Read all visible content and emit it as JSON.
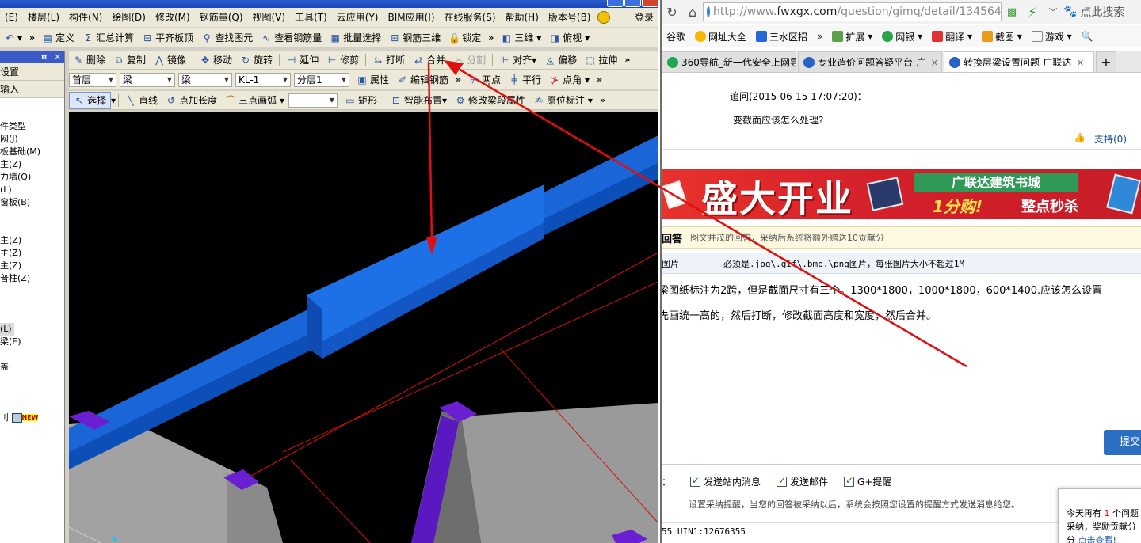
{
  "cad": {
    "menu": [
      "(E)",
      "楼层(L)",
      "构件(N)",
      "绘图(D)",
      "修改(M)",
      "钢筋量(Q)",
      "视图(V)",
      "工具(T)",
      "云应用(Y)",
      "BIM应用(I)",
      "在线服务(S)",
      "帮助(H)",
      "版本号(B)"
    ],
    "login": "登录",
    "toolbar1": {
      "chevron": "»",
      "items": [
        "定义",
        "汇总计算",
        "平齐板顶",
        "查找图元",
        "查看钢筋量",
        "批量选择",
        "钢筋三维",
        "锁定"
      ],
      "view_3d": "三维",
      "view_top": "俯视"
    },
    "toolbar2": [
      "删除",
      "复制",
      "镜像",
      "移动",
      "旋转",
      "延伸",
      "修剪",
      "打断",
      "合并",
      "分割",
      "对齐",
      "偏移",
      "拉伸"
    ],
    "toolbar3": {
      "floor": "首层",
      "type1": "梁",
      "type2": "梁",
      "member": "KL-1",
      "layer": "分层1",
      "buttons": [
        "属性",
        "编辑钢筋",
        "两点",
        "平行",
        "点角"
      ]
    },
    "toolbar4": {
      "buttons": [
        "选择",
        "直线",
        "点加长度",
        "三点画弧",
        "矩形",
        "智能布置",
        "修改梁段属性",
        "原位标注"
      ]
    },
    "left_panel": {
      "head_pin": "𝛑",
      "head_close": "×",
      "tab1": "设置",
      "tab2": "输入",
      "tree": [
        "件类型",
        "网(J)",
        "板基础(M)",
        "主(Z)",
        "力墙(Q)",
        "(L)",
        "窗板(B)",
        "",
        "",
        "主(Z)",
        "主(Z)",
        "主(Z)",
        "普柱(Z)",
        "",
        "",
        "",
        "(L)",
        "梁(E)",
        "",
        "盖",
        "",
        "",
        "",
        "刂"
      ],
      "new_badge": "NEW"
    }
  },
  "browser": {
    "url_prefix": "http://www.",
    "url_host": "fwxgx.com",
    "url_path": "/question/gimq/detail/1345649",
    "search_placeholder": "点此搜索",
    "favorites": [
      "谷歌",
      "网址大全",
      "三水区招",
      "扩展",
      "网银",
      "翻译",
      "截图",
      "游戏"
    ],
    "fav_chevron": "»",
    "tabs": [
      {
        "title": "360导航_新一代安全上网导",
        "active": false
      },
      {
        "title": "专业造价问题答疑平台-广",
        "active": false
      },
      {
        "title": "转换层梁设置问题-广联达",
        "active": true
      }
    ],
    "new_tab": "+",
    "question": {
      "followup": "追问(2015-06-15 17:07:20)：",
      "followup_text": "变截面应该怎么处理?",
      "support": "支持(0)"
    },
    "banner": {
      "big": "盛大开业",
      "green": "广联达建筑书城",
      "yellow": "1分购!",
      "white": "整点秒杀"
    },
    "answer_bar": {
      "label": "回答",
      "hint": "图文并茂的回答，采纳后系统将额外赠送10贡献分"
    },
    "image_bar": {
      "label": "图片",
      "hint": "必须是.jpg\\.gif\\.bmp.\\png图片，每张图片大小不超过1M"
    },
    "answer_lines": [
      "梁图纸标注为2跨，但是截面尺寸有三个。1300*1800，1000*1800，600*1400.应该怎么设置",
      "先画统一高的，然后打断，修改截面高度和宽度，然后合并。"
    ],
    "submit": "提交回",
    "options": [
      "发送站内消息",
      "发送邮件",
      "G+提醒"
    ],
    "options_colon": "：",
    "options_note": "设置采纳提醒，当您的回答被采纳以后，系统会按照您设置的提醒方式发送消息给您。",
    "footer": "55 UIN1:12676355",
    "popup": {
      "line1_a": "今天再有",
      "line1_n": "1",
      "line1_b": "个问题",
      "line2": "采纳，奖励贡献分",
      "line3_a": "分",
      "line3_link": "点击查看!"
    }
  },
  "colors": {
    "beam": "#1565d8",
    "column": "#6a1fd0",
    "slab": "#9e9e9e",
    "annotation_arrow": "#e01010"
  }
}
